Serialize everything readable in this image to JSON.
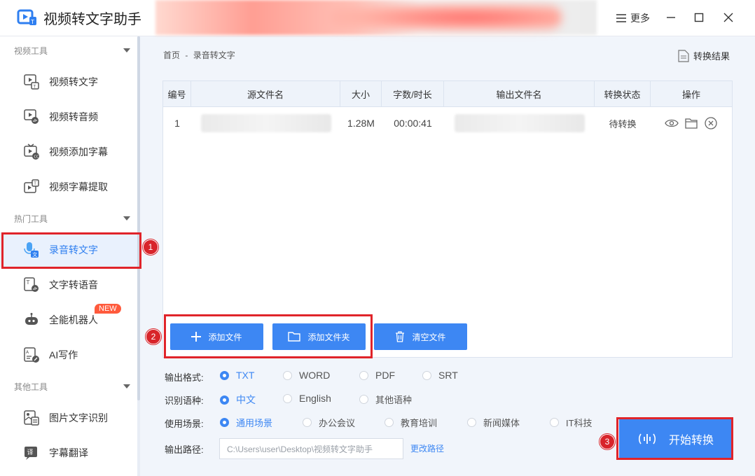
{
  "app": {
    "title": "视频转文字助手",
    "more": "更多"
  },
  "sidebar": {
    "sections": [
      {
        "title": "视频工具"
      },
      {
        "title": "热门工具"
      },
      {
        "title": "其他工具"
      }
    ],
    "items": [
      {
        "label": "视频转文字",
        "icon": "video-text-icon"
      },
      {
        "label": "视频转音频",
        "icon": "video-audio-icon"
      },
      {
        "label": "视频添加字幕",
        "icon": "subtitle-add-icon"
      },
      {
        "label": "视频字幕提取",
        "icon": "subtitle-extract-icon"
      },
      {
        "label": "录音转文字",
        "icon": "microphone-icon",
        "active": true
      },
      {
        "label": "文字转语音",
        "icon": "text-speech-icon"
      },
      {
        "label": "全能机器人",
        "icon": "robot-icon",
        "badge": "NEW"
      },
      {
        "label": "AI写作",
        "icon": "ai-write-icon"
      },
      {
        "label": "图片文字识别",
        "icon": "image-ocr-icon"
      },
      {
        "label": "字幕翻译",
        "icon": "translate-icon"
      }
    ]
  },
  "breadcrumb": {
    "home": "首页",
    "sep": "-",
    "current": "录音转文字"
  },
  "result_button": "转换结果",
  "table": {
    "columns": [
      "编号",
      "源文件名",
      "大小",
      "字数/时长",
      "输出文件名",
      "转换状态",
      "操作"
    ],
    "rows": [
      {
        "index": "1",
        "size": "1.28M",
        "duration": "00:00:41",
        "status": "待转换"
      }
    ]
  },
  "buttons": {
    "add_file": "添加文件",
    "add_folder": "添加文件夹",
    "clear_files": "清空文件"
  },
  "options": {
    "format": {
      "label": "输出格式:",
      "choices": [
        "TXT",
        "WORD",
        "PDF",
        "SRT"
      ],
      "selected": "TXT"
    },
    "language": {
      "label": "识别语种:",
      "choices": [
        "中文",
        "English",
        "其他语种"
      ],
      "selected": "中文"
    },
    "scene": {
      "label": "使用场景:",
      "choices": [
        "通用场景",
        "办公会议",
        "教育培训",
        "新闻媒体",
        "IT科技"
      ],
      "selected": "通用场景"
    },
    "path": {
      "label": "输出路径:",
      "value": "C:\\Users\\user\\Desktop\\视频转文字助手",
      "change": "更改路径"
    }
  },
  "start_button": "开始转换",
  "markers": [
    "1",
    "2",
    "3"
  ],
  "colors": {
    "accent": "#3d87f3",
    "marker": "#d8242a"
  }
}
